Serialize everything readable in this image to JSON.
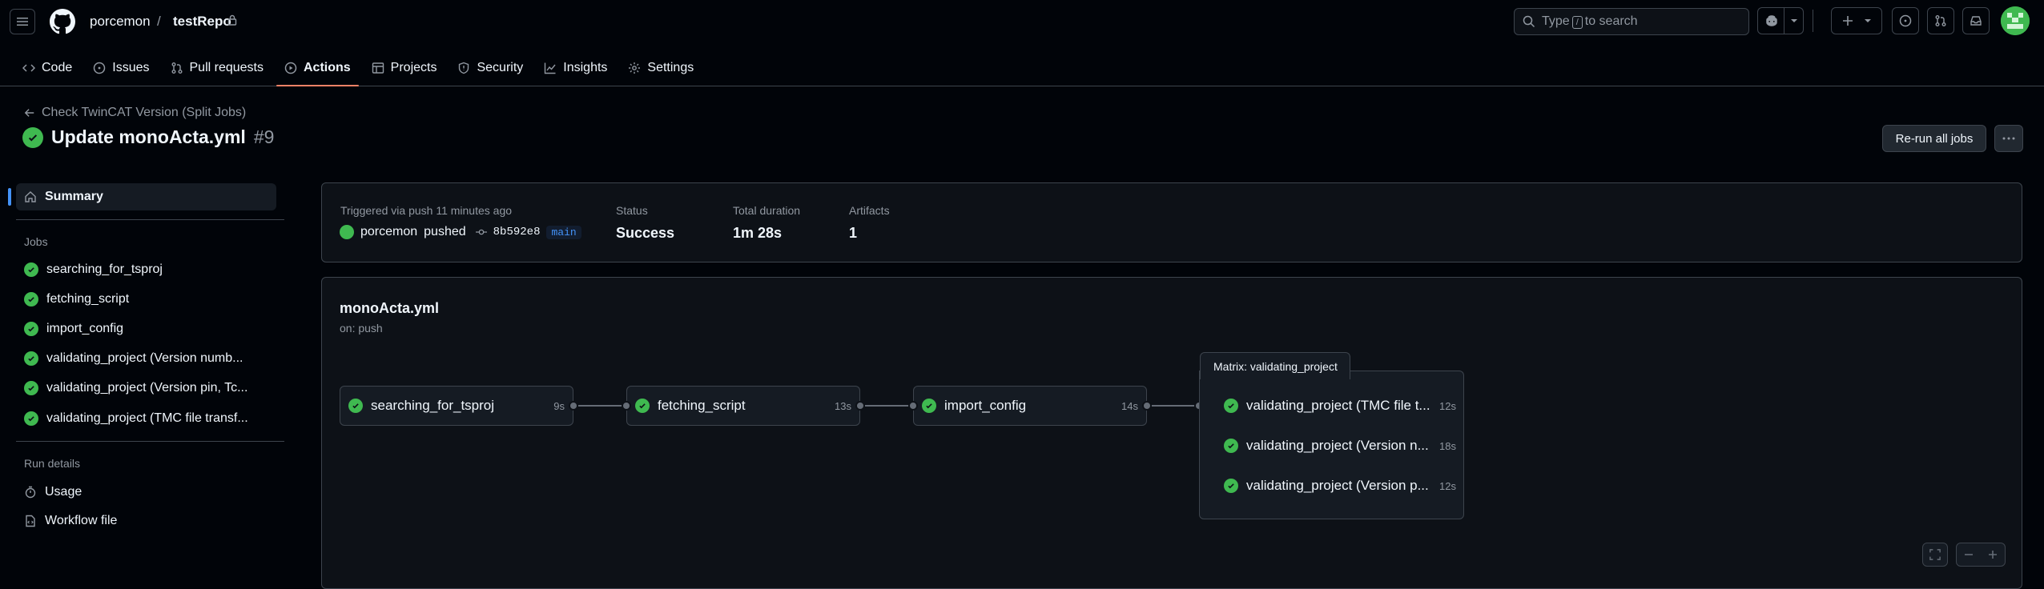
{
  "header": {
    "owner": "porcemon",
    "separator": "/",
    "repo": "testRepo",
    "search": {
      "prefix": "Type",
      "key": "/",
      "suffix": "to search"
    },
    "avatar_color": "#3fb950"
  },
  "tabs": [
    {
      "label": "Code",
      "icon": "code-icon"
    },
    {
      "label": "Issues",
      "icon": "issue-icon"
    },
    {
      "label": "Pull requests",
      "icon": "pull-request-icon"
    },
    {
      "label": "Actions",
      "icon": "play-icon",
      "active": true
    },
    {
      "label": "Projects",
      "icon": "table-icon"
    },
    {
      "label": "Security",
      "icon": "shield-icon"
    },
    {
      "label": "Insights",
      "icon": "graph-icon"
    },
    {
      "label": "Settings",
      "icon": "gear-icon"
    }
  ],
  "run": {
    "back_label": "Check TwinCAT Version (Split Jobs)",
    "title": "Update monoActa.yml",
    "number": "#9",
    "rerun_label": "Re-run all jobs"
  },
  "sidebar": {
    "summary_label": "Summary",
    "jobs_heading": "Jobs",
    "jobs": [
      "searching_for_tsproj",
      "fetching_script",
      "import_config",
      "validating_project (Version numb...",
      "validating_project (Version pin, Tc...",
      "validating_project (TMC file transf..."
    ],
    "run_details_heading": "Run details",
    "usage_label": "Usage",
    "workflow_file_label": "Workflow file"
  },
  "summary": {
    "triggered": "Triggered via push 11 minutes ago",
    "actor": "porcemon",
    "action": "pushed",
    "sha": "8b592e8",
    "branch": "main",
    "status_label": "Status",
    "status_value": "Success",
    "duration_label": "Total duration",
    "duration_value": "1m 28s",
    "artifacts_label": "Artifacts",
    "artifacts_value": "1"
  },
  "workflow": {
    "file": "monoActa.yml",
    "trigger": "on: push",
    "jobs": [
      {
        "name": "searching_for_tsproj",
        "duration": "9s"
      },
      {
        "name": "fetching_script",
        "duration": "13s"
      },
      {
        "name": "import_config",
        "duration": "14s"
      }
    ],
    "matrix_label": "Matrix: validating_project",
    "matrix_jobs": [
      {
        "name": "validating_project (TMC file t...",
        "duration": "12s"
      },
      {
        "name": "validating_project (Version n...",
        "duration": "18s"
      },
      {
        "name": "validating_project (Version p...",
        "duration": "12s"
      }
    ]
  }
}
